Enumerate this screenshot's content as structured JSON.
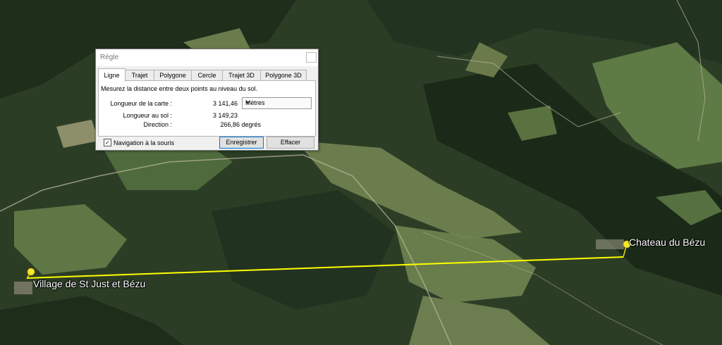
{
  "map": {
    "placemarks": [
      {
        "label": "Village de St Just et Bézu"
      },
      {
        "label": "Chateau du Bézu"
      }
    ],
    "colors": {
      "measure_line": "#ffff00",
      "pin": "#f7e62a"
    }
  },
  "dialog": {
    "title": "Règle",
    "tabs": [
      {
        "label": "Ligne"
      },
      {
        "label": "Trajet"
      },
      {
        "label": "Polygone"
      },
      {
        "label": "Cercle"
      },
      {
        "label": "Trajet 3D"
      },
      {
        "label": "Polygone 3D"
      }
    ],
    "description": "Mesurez la distance entre deux points au niveau du sol.",
    "map_length_label": "Longueur de la carte :",
    "map_length_value": "3 141,46",
    "unit_selected": "Mètres",
    "ground_length_label": "Longueur au sol :",
    "ground_length_value": "3 149,23",
    "direction_label": "Direction :",
    "direction_value": "266,86 degrés",
    "mouse_nav_label": "Navigation à la souris",
    "mouse_nav_checked": true,
    "checkmark": "✓",
    "save_label": "Enregistrer",
    "clear_label": "Effacer"
  }
}
